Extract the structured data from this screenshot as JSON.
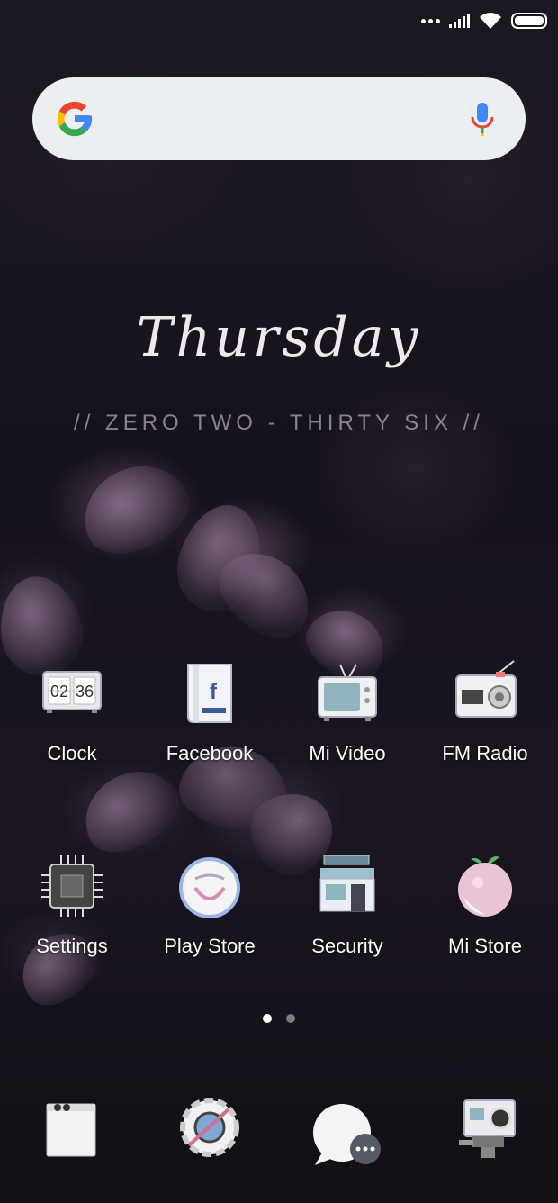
{
  "status_bar": {
    "icons": [
      "more-dots-icon",
      "signal-icon",
      "wifi-icon",
      "battery-icon"
    ]
  },
  "search": {
    "logo": "G",
    "value": "",
    "placeholder": "",
    "icons": [
      "google-logo-icon",
      "microphone-icon"
    ]
  },
  "widget": {
    "day": "Thursday",
    "time_text": "// ZERO TWO - THIRTY SIX //"
  },
  "apps": [
    {
      "label": "Clock",
      "icon": "clock-icon",
      "clock_hour": "02",
      "clock_min": "36"
    },
    {
      "label": "Facebook",
      "icon": "facebook-icon"
    },
    {
      "label": "Mi Video",
      "icon": "tv-icon"
    },
    {
      "label": "FM Radio",
      "icon": "radio-icon"
    },
    {
      "label": "Settings",
      "icon": "chip-icon"
    },
    {
      "label": "Play Store",
      "icon": "smile-bag-icon"
    },
    {
      "label": "Security",
      "icon": "building-icon"
    },
    {
      "label": "Mi Store",
      "icon": "peach-icon"
    }
  ],
  "pages": {
    "count": 2,
    "active": 1
  },
  "dock": {
    "icons": [
      "phone-icon",
      "browser-icon",
      "messages-icon",
      "camera-icon"
    ]
  },
  "colors": {
    "accent_red": "#ea4335",
    "accent_blue": "#4285f4",
    "accent_green": "#34a853",
    "accent_yellow": "#fbbc05",
    "label": "#ffffff"
  }
}
